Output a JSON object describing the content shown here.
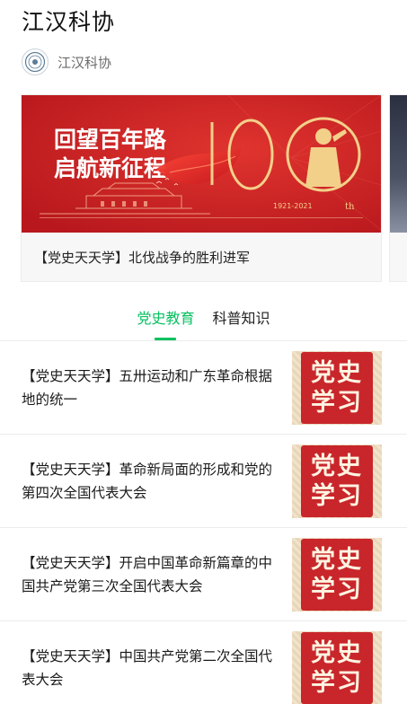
{
  "header": {
    "title": "江汉科协",
    "account_name": "江汉科协"
  },
  "banner": {
    "headline_line1": "回望百年路",
    "headline_line2": "启航新征程",
    "number": "100",
    "years": "1921-2021",
    "suffix": "th",
    "caption": "【党史天天学】北伐战争的胜利进军",
    "colors": {
      "red": "#c8262b",
      "gold": "#f3d08a"
    }
  },
  "tabs": [
    {
      "label": "党史教育",
      "active": true
    },
    {
      "label": "科普知识",
      "active": false
    }
  ],
  "articles": [
    {
      "title": "【党史天天学】五卅运动和广东革命根据地的统一",
      "thumb_line1": "党史",
      "thumb_line2": "学习"
    },
    {
      "title": "【党史天天学】革命新局面的形成和党的第四次全国代表大会",
      "thumb_line1": "党史",
      "thumb_line2": "学习"
    },
    {
      "title": "【党史天天学】开启中国革命新篇章的中国共产党第三次全国代表大会",
      "thumb_line1": "党史",
      "thumb_line2": "学习"
    },
    {
      "title": "【党史天天学】中国共产党第二次全国代表大会",
      "thumb_line1": "党史",
      "thumb_line2": "学习"
    }
  ],
  "icons": {
    "account_logo": "organization-seal-icon"
  },
  "accent_color": "#07c160"
}
